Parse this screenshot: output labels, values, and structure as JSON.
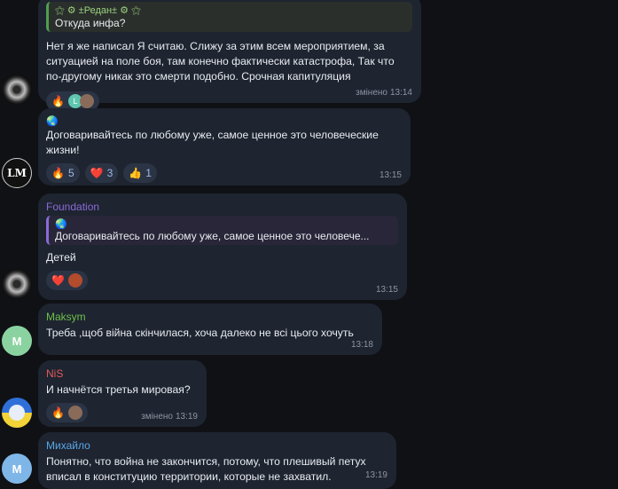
{
  "messages": [
    {
      "reply": {
        "name": "±Редан±",
        "text": "Откуда инфа?"
      },
      "text": "Нет я же написал Я считаю. Слижу за этим всем мероприятием, за ситуацией на поле боя, там конечно  фактически катастрофа, Так что по-другому никак это смерти подобно. Срочная капитуляция",
      "reactions": {
        "fire": "🔥",
        "mini1": "L",
        "mini2": ""
      },
      "edited": "змінено",
      "time": "13:14"
    },
    {
      "avatar": "LM",
      "globe": "🌏",
      "text": "Договаривайтесь по любому уже, самое ценное это человеческие жизни!",
      "reactions": [
        {
          "emoji": "🔥",
          "count": "5"
        },
        {
          "emoji": "❤️",
          "count": "3"
        },
        {
          "emoji": "👍",
          "count": "1"
        }
      ],
      "time": "13:15"
    },
    {
      "sender": "Foundation",
      "sender_color": "#8b6ad8",
      "reply": {
        "globe": "🌏",
        "text": "Договаривайтесь по любому уже, самое ценное это человече..."
      },
      "text": "Детей",
      "reactions": {
        "heart": "❤️"
      },
      "time": "13:15"
    },
    {
      "avatar": "M",
      "sender": "Maksym",
      "sender_color": "#6cc04a",
      "text": "Треба ,щоб війна скінчилася, хоча далеко не всі цього хочуть",
      "time": "13:18"
    },
    {
      "sender": "NiS",
      "sender_color": "#e25b5b",
      "text": "И начнётся третья мировая?",
      "reactions": {
        "fire": "🔥"
      },
      "edited": "змінено",
      "time": "13:19"
    },
    {
      "avatar": "M",
      "sender": "Михайло",
      "sender_color": "#5aa7e6",
      "text": "Понятно, что война не закончится, потому, что плешивый петух вписал в конституцию территории, которые не захватил.",
      "time": "13:19"
    }
  ]
}
